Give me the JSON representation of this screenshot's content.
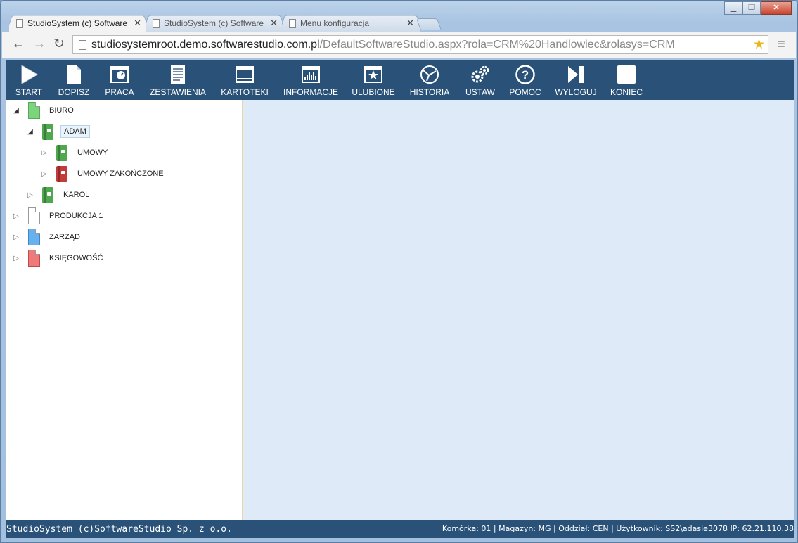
{
  "browser": {
    "tabs": [
      {
        "label": "StudioSystem (c) Software",
        "active": true
      },
      {
        "label": "StudioSystem (c) Software",
        "active": false
      },
      {
        "label": "Menu konfiguracja",
        "active": false
      }
    ],
    "url_host": "studiosystemroot.demo.softwarestudio.com.pl",
    "url_path": "/DefaultSoftwareStudio.aspx?rola=CRM%20Handlowiec&rolasys=CRM",
    "nav": {
      "back": "←",
      "forward": "→",
      "reload": "↻",
      "star": "★",
      "menu": "≡"
    },
    "window_buttons": {
      "min": "▁",
      "max": "❐",
      "close": "✕"
    }
  },
  "toolbar": {
    "items": [
      {
        "id": "start",
        "label": "START",
        "icon": "play-icon"
      },
      {
        "id": "dopisz",
        "label": "DOPISZ",
        "icon": "new-page-icon"
      },
      {
        "id": "praca",
        "label": "PRACA",
        "icon": "dashboard-window-icon"
      },
      {
        "id": "zestawienia",
        "label": "ZESTAWIENIA",
        "icon": "report-document-icon"
      },
      {
        "id": "kartoteki",
        "label": "KARTOTEKI",
        "icon": "window-list-icon"
      },
      {
        "id": "informacje",
        "label": "INFORMACJE",
        "icon": "bar-chart-window-icon"
      },
      {
        "id": "ulubione",
        "label": "ULUBIONE",
        "icon": "star-window-icon"
      },
      {
        "id": "historia",
        "label": "HISTORIA",
        "icon": "history-globe-icon"
      },
      {
        "id": "ustaw",
        "label": "USTAW",
        "icon": "gears-icon"
      },
      {
        "id": "pomoc",
        "label": "POMOC",
        "icon": "help-circle-icon"
      },
      {
        "id": "wyloguj",
        "label": "WYLOGUJ",
        "icon": "logout-skip-icon"
      },
      {
        "id": "koniec",
        "label": "KONIEC",
        "icon": "stop-square-icon"
      }
    ]
  },
  "tree": {
    "nodes": [
      {
        "label": "BIURO",
        "expanded": true,
        "icon": "green-document-icon",
        "level": 0
      },
      {
        "label": "ADAM",
        "expanded": true,
        "icon": "green-binder-icon",
        "level": 1,
        "selected": true
      },
      {
        "label": "UMOWY",
        "expanded": false,
        "icon": "green-binder-icon",
        "level": 2
      },
      {
        "label": "UMOWY ZAKOŃCZONE",
        "expanded": false,
        "icon": "red-binder-icon",
        "level": 2
      },
      {
        "label": "KAROL",
        "expanded": false,
        "icon": "green-binder-icon",
        "level": 1
      },
      {
        "label": "PRODUKCJA 1",
        "expanded": false,
        "icon": "white-document-icon",
        "level": 0
      },
      {
        "label": "ZARZĄD",
        "expanded": false,
        "icon": "blue-document-icon",
        "level": 0
      },
      {
        "label": "KSIĘGOWOŚĆ",
        "expanded": false,
        "icon": "red-document-icon",
        "level": 0
      }
    ]
  },
  "status": {
    "left": "StudioSystem (c)SoftwareStudio Sp. z o.o.",
    "right": "Komórka: 01 | Magazyn: MG | Oddział: CEN | Użytkownik: SS2\\adasie3078 IP: 62.21.110.38"
  },
  "colors": {
    "toolbar_bg": "#2a5278",
    "content_bg": "#deeaf8",
    "green": "#6cc96c",
    "red": "#e05a5a",
    "blue": "#5aa7e8"
  }
}
